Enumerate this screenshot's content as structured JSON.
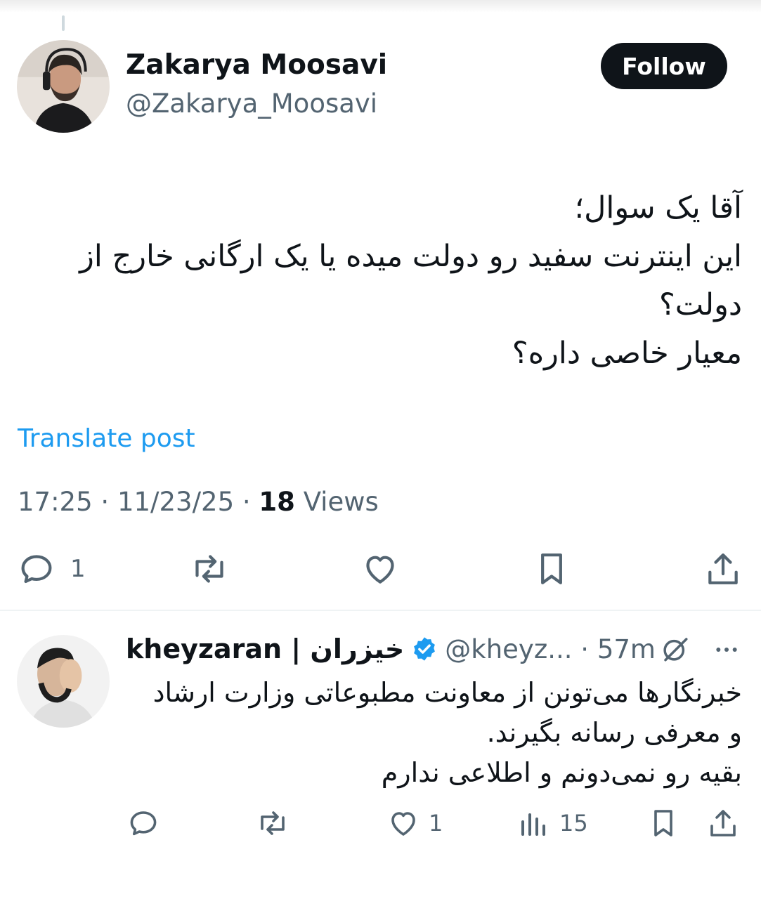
{
  "post": {
    "author": {
      "display_name": "Zakarya Moosavi",
      "handle": "@Zakarya_Moosavi"
    },
    "follow_label": "Follow",
    "text_lines": [
      "آقا یک سوال؛",
      "این اینترنت سفید رو دولت میده یا یک ارگانی خارج از",
      "دولت؟",
      "معیار خاصی داره؟"
    ],
    "translate_label": "Translate post",
    "time": "17:25",
    "date": "11/23/25",
    "separator": "·",
    "views_count": "18",
    "views_label": "Views",
    "actions": {
      "reply_count": "1"
    }
  },
  "reply": {
    "author": {
      "display_name": "kheyzaran | خیزران",
      "handle": "@kheyz...",
      "verified": true
    },
    "time": "57m",
    "text_lines": [
      "خبرنگارها می‌تونن از معاونت مطبوعاتی وزارت ارشاد",
      "و معرفی رسانه بگیرند.",
      "بقیه رو نمی‌دونم و اطلاعی ندارم"
    ],
    "actions": {
      "like_count": "1",
      "views_count": "15"
    }
  },
  "colors": {
    "text": "#0f1419",
    "secondary": "#536471",
    "accent": "#1d9bf0",
    "divider": "#eff3f4"
  },
  "icons": [
    "reply-icon",
    "repost-icon",
    "like-icon",
    "bookmark-icon",
    "share-icon",
    "views-icon",
    "verified-badge-icon",
    "grok-icon",
    "more-icon"
  ]
}
